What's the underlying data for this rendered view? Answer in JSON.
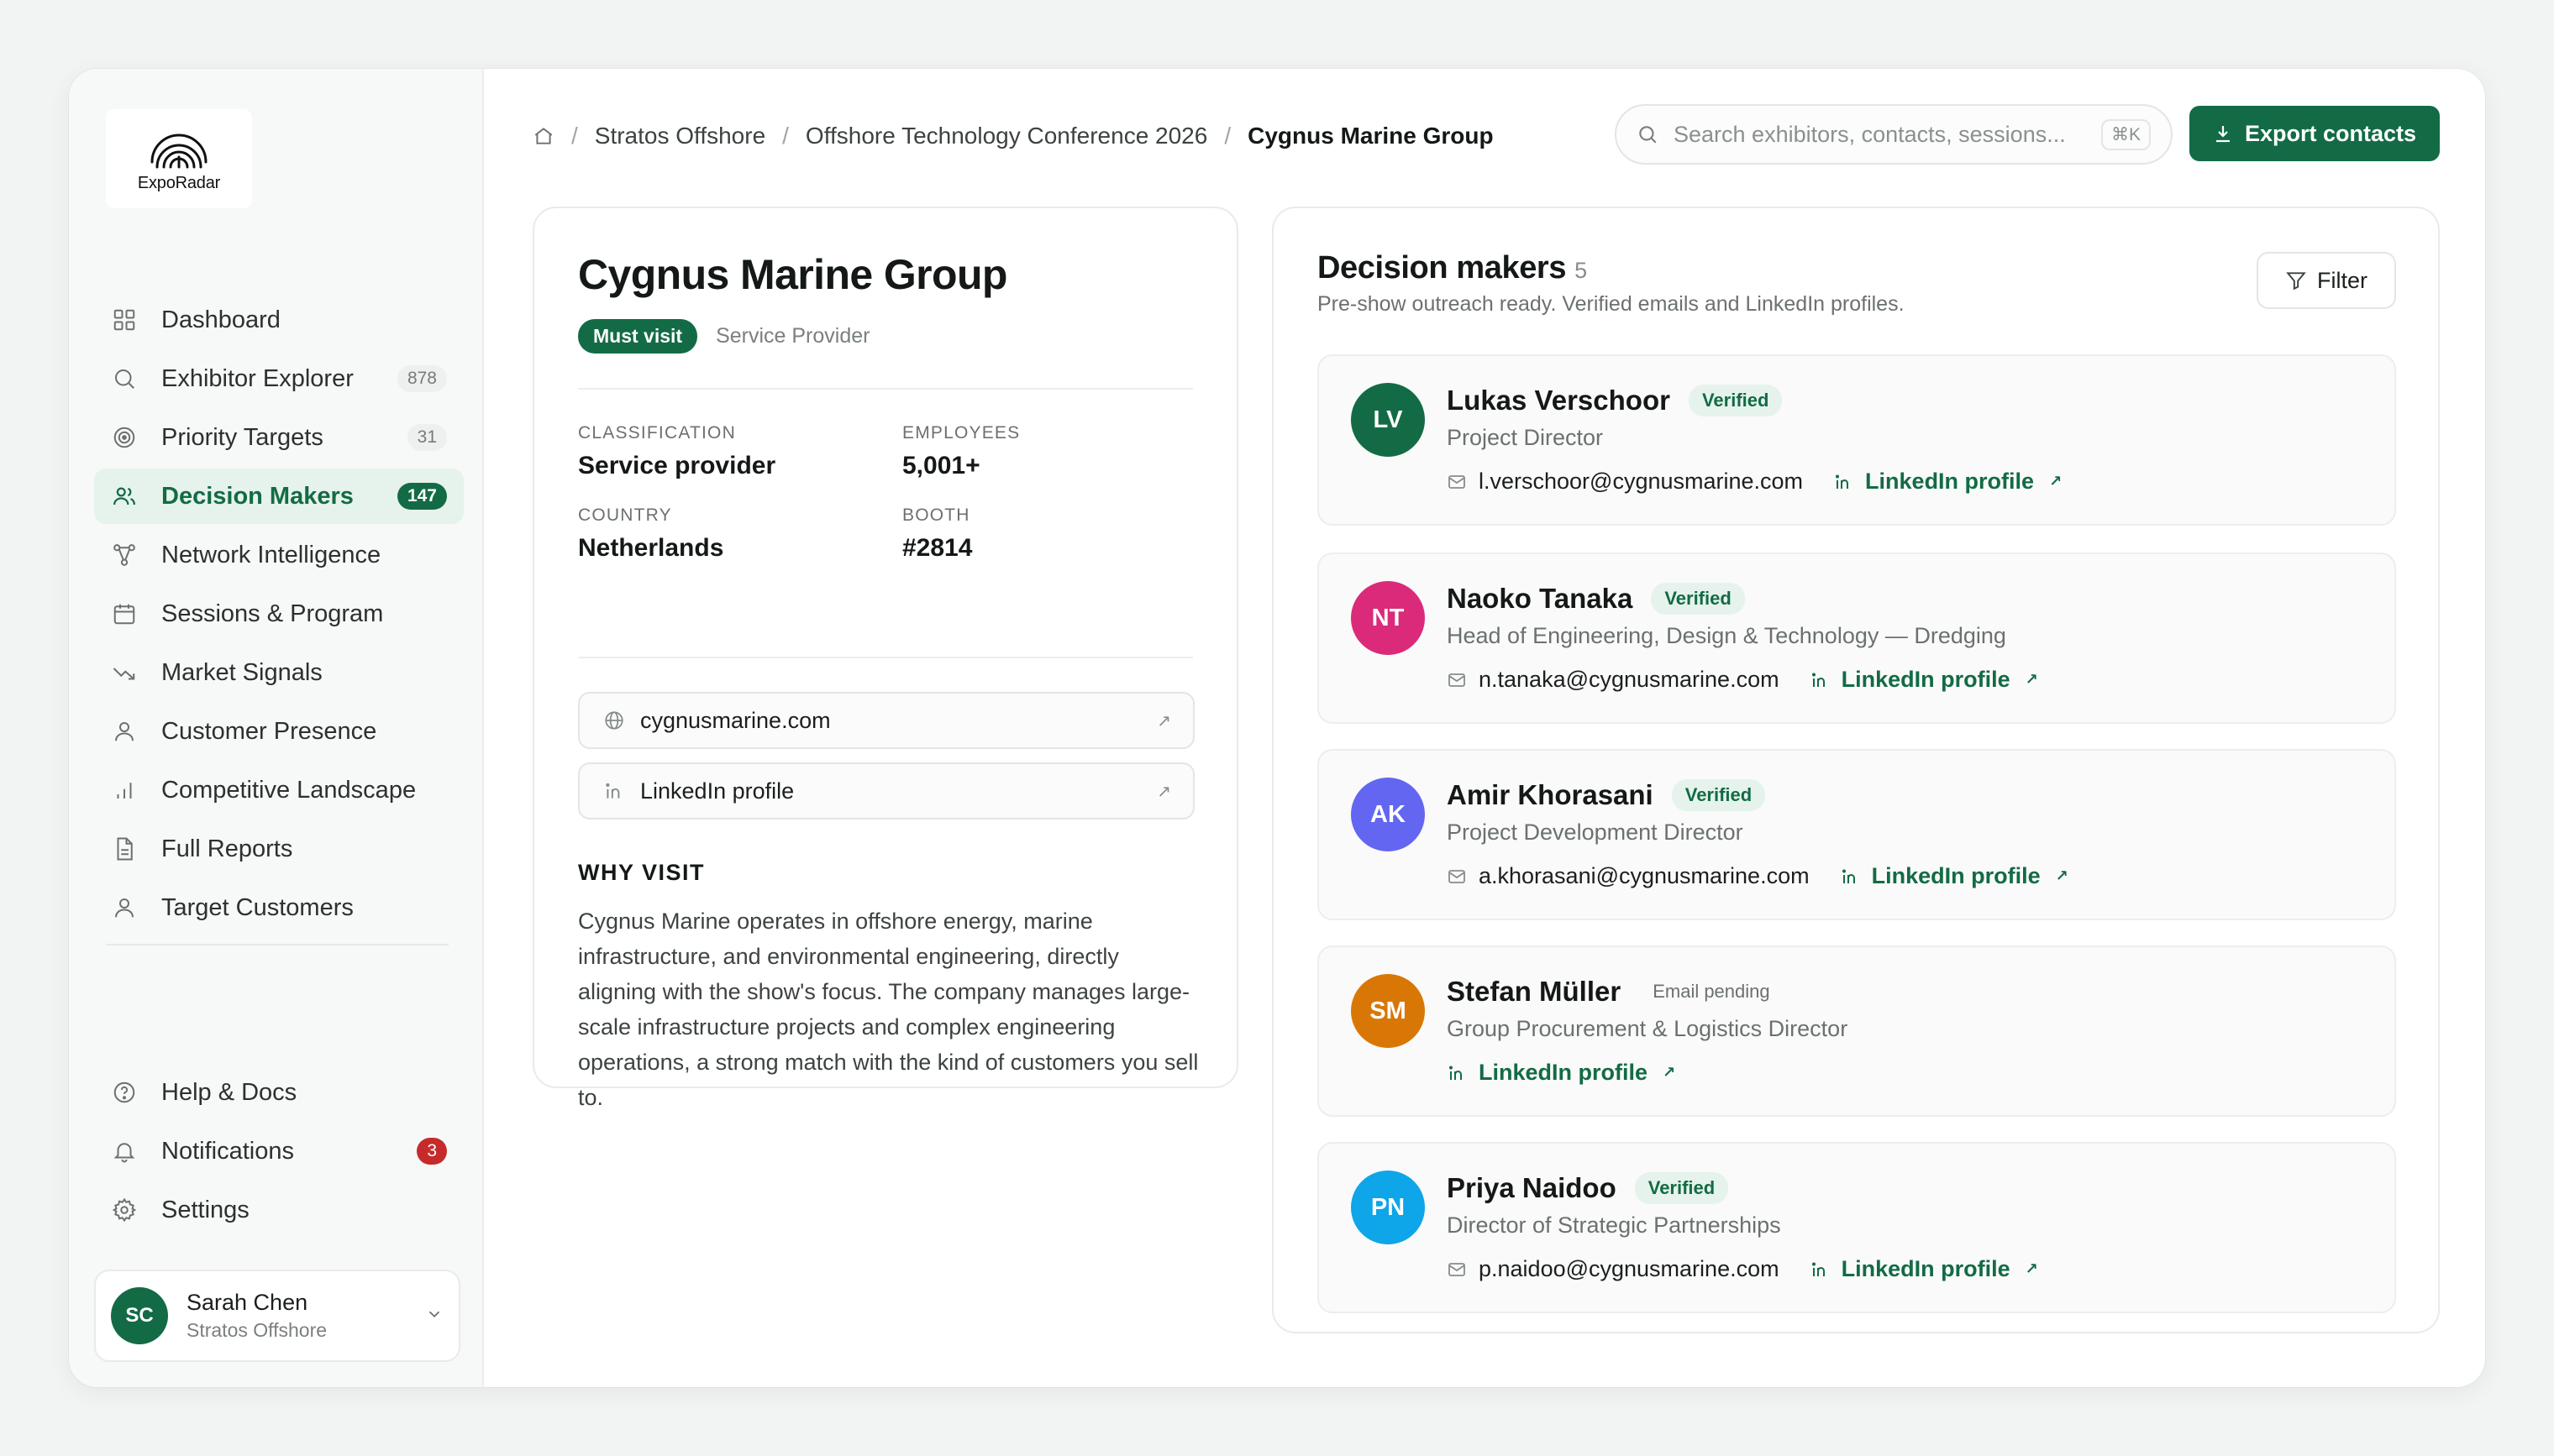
{
  "app": {
    "logo_text": "ExpoRadar"
  },
  "sidebar": {
    "items": [
      {
        "label": "Dashboard",
        "icon": "grid-icon",
        "count": ""
      },
      {
        "label": "Exhibitor Explorer",
        "icon": "search-icon",
        "count": "878"
      },
      {
        "label": "Priority Targets",
        "icon": "target-icon",
        "count": "31"
      },
      {
        "label": "Decision Makers",
        "icon": "users-icon",
        "count": "147",
        "active": true
      },
      {
        "label": "Network Intelligence",
        "icon": "network-icon",
        "count": ""
      },
      {
        "label": "Sessions & Program",
        "icon": "calendar-icon",
        "count": ""
      },
      {
        "label": "Market Signals",
        "icon": "trend-icon",
        "count": ""
      },
      {
        "label": "Customer Presence",
        "icon": "user-icon",
        "count": ""
      },
      {
        "label": "Competitive Landscape",
        "icon": "bar-chart-icon",
        "count": ""
      },
      {
        "label": "Full Reports",
        "icon": "document-icon",
        "count": ""
      },
      {
        "label": "Target Customers",
        "icon": "user-icon",
        "count": ""
      }
    ],
    "bottom": [
      {
        "label": "Help & Docs",
        "icon": "help-icon",
        "count": ""
      },
      {
        "label": "Notifications",
        "icon": "bell-icon",
        "count": "3"
      },
      {
        "label": "Settings",
        "icon": "gear-icon",
        "count": ""
      }
    ],
    "user": {
      "initials": "SC",
      "name": "Sarah Chen",
      "org": "Stratos Offshore"
    }
  },
  "header": {
    "breadcrumb": [
      "Stratos Offshore",
      "Offshore Technology Conference 2026",
      "Cygnus Marine Group"
    ],
    "search_placeholder": "Search exhibitors, contacts, sessions...",
    "search_shortcut": "⌘K",
    "export_label": "Export contacts"
  },
  "company": {
    "name": "Cygnus Marine Group",
    "priority_tag": "Must visit",
    "type": "Service Provider",
    "facts": [
      {
        "key": "CLASSIFICATION",
        "value": "Service provider"
      },
      {
        "key": "EMPLOYEES",
        "value": "5,001+"
      },
      {
        "key": "COUNTRY",
        "value": "Netherlands"
      },
      {
        "key": "BOOTH",
        "value": "#2814"
      }
    ],
    "website": "cygnusmarine.com",
    "linkedin": "LinkedIn profile",
    "why_title": "WHY VISIT",
    "why_text": "Cygnus Marine operates in offshore energy, marine infrastructure, and environmental engineering, directly aligning with the show's focus. The company manages large-scale infrastructure projects and complex engineering operations, a strong match with the kind of customers you sell to."
  },
  "decision_makers": {
    "title": "Decision makers",
    "count": "5",
    "subtitle": "Pre-show outreach ready. Verified emails and LinkedIn profiles.",
    "filter_label": "Filter",
    "linkedin_label": "LinkedIn profile",
    "people": [
      {
        "initials": "LV",
        "name": "Lukas Verschoor",
        "status": "Verified",
        "role": "Project Director",
        "email": "l.verschoor@cygnusmarine.com",
        "color": "#136b45"
      },
      {
        "initials": "NT",
        "name": "Naoko Tanaka",
        "status": "Verified",
        "role": "Head of Engineering, Design & Technology — Dredging",
        "email": "n.tanaka@cygnusmarine.com",
        "color": "#db2a7a"
      },
      {
        "initials": "AK",
        "name": "Amir Khorasani",
        "status": "Verified",
        "role": "Project Development Director",
        "email": "a.khorasani@cygnusmarine.com",
        "color": "#6366f1"
      },
      {
        "initials": "SM",
        "name": "Stefan Müller",
        "status": "Email pending",
        "role": "Group Procurement & Logistics Director",
        "email": "",
        "color": "#d97706"
      },
      {
        "initials": "PN",
        "name": "Priya Naidoo",
        "status": "Verified",
        "role": "Director of Strategic Partnerships",
        "email": "p.naidoo@cygnusmarine.com",
        "color": "#0ea5e9"
      }
    ]
  },
  "colors": {
    "accent": "#136b45",
    "accent_soft": "#e6f3ec",
    "alert": "#c62b2b"
  }
}
